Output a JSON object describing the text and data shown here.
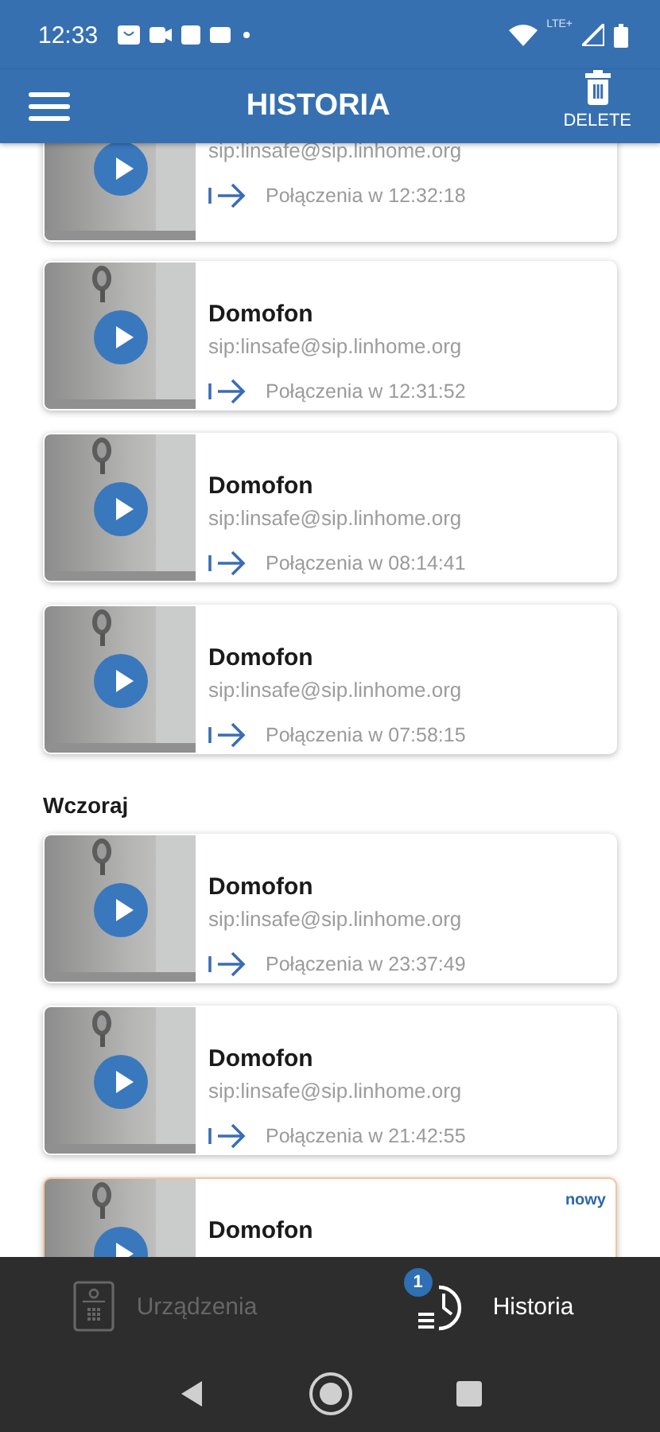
{
  "status_bar": {
    "time": "12:33",
    "network": "LTE+"
  },
  "app_bar": {
    "title": "HISTORIA",
    "delete_label": "DELETE"
  },
  "sections": [
    {
      "cards": [
        {
          "address": "sip:linsafe@sip.linhome.org",
          "call": "Połączenia w 12:32:18",
          "new": false
        },
        {
          "name": "Domofon",
          "address": "sip:linsafe@sip.linhome.org",
          "call": "Połączenia w 12:31:52",
          "new": false
        },
        {
          "name": "Domofon",
          "address": "sip:linsafe@sip.linhome.org",
          "call": "Połączenia w 08:14:41",
          "new": false
        },
        {
          "name": "Domofon",
          "address": "sip:linsafe@sip.linhome.org",
          "call": "Połączenia w 07:58:15",
          "new": false
        }
      ]
    },
    {
      "heading": "Wczoraj",
      "cards": [
        {
          "name": "Domofon",
          "address": "sip:linsafe@sip.linhome.org",
          "call": "Połączenia w 23:37:49",
          "new": false
        },
        {
          "name": "Domofon",
          "address": "sip:linsafe@sip.linhome.org",
          "call": "Połączenia w 21:42:55",
          "new": false
        },
        {
          "name": "Domofon",
          "new": true,
          "new_label": "nowy"
        }
      ]
    }
  ],
  "bottom_nav": [
    {
      "kind": "devices",
      "label": "Urządzenia",
      "selected": false
    },
    {
      "kind": "history",
      "label": "Historia",
      "selected": true,
      "badge": "1"
    }
  ]
}
